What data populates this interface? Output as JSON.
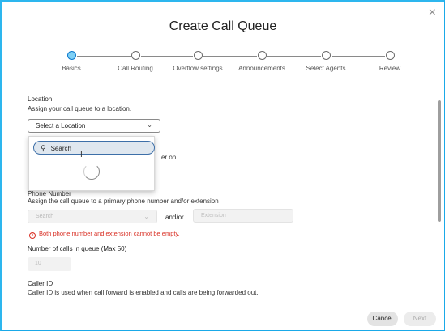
{
  "dialog": {
    "title": "Create Call Queue",
    "close_icon": "×",
    "steps": [
      {
        "label": "Basics",
        "active": true
      },
      {
        "label": "Call Routing",
        "active": false
      },
      {
        "label": "Overflow settings",
        "active": false
      },
      {
        "label": "Announcements",
        "active": false
      },
      {
        "label": "Select Agents",
        "active": false
      },
      {
        "label": "Review",
        "active": false
      }
    ]
  },
  "location": {
    "heading": "Location",
    "description": "Assign your call queue to a location.",
    "select_value": "Select a Location",
    "dropdown": {
      "search_placeholder": "Search",
      "search_icon": "search-icon",
      "loading": true
    },
    "hidden_tail_text": "er on."
  },
  "phone": {
    "heading": "Phone Number",
    "description": "Assign the call queue to a primary phone number and/or extension",
    "number_placeholder": "Search",
    "and_or": "and/or",
    "extension_placeholder": "Extension",
    "error": "Both phone number and extension cannot be empty."
  },
  "calls_in_queue": {
    "heading": "Number of calls in queue (Max 50)",
    "value": "10"
  },
  "caller_id": {
    "heading": "Caller ID",
    "description": "Caller ID is used when call forward is enabled and calls are being forwarded out."
  },
  "footer": {
    "cancel_label": "Cancel",
    "next_label": "Next"
  },
  "colors": {
    "accent": "#1aa9e8",
    "error": "#d93025",
    "active_step": "#7fd0f5"
  }
}
